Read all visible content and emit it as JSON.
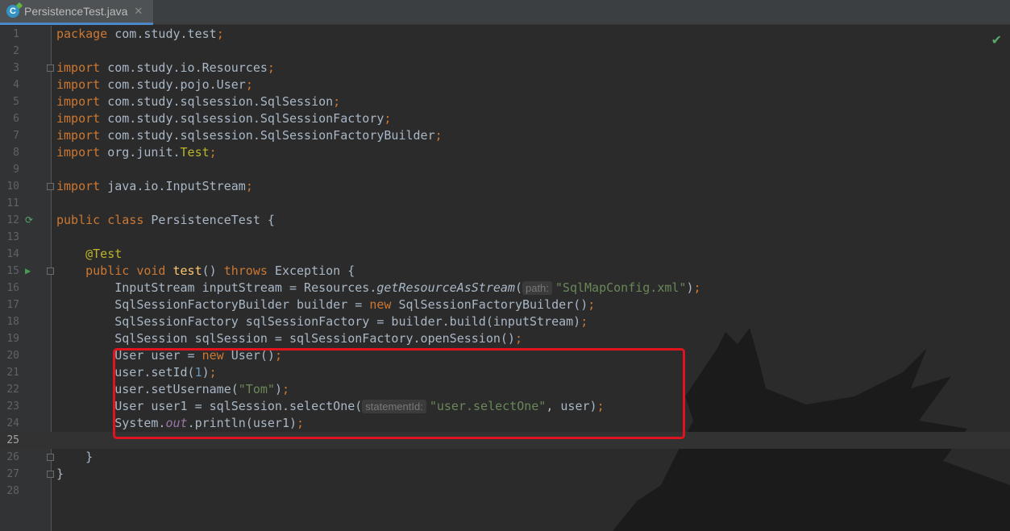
{
  "tab": {
    "title": "PersistenceTest.java",
    "close": "✕",
    "icon_label": "C",
    "icon": "java-class-icon"
  },
  "editor": {
    "current_line": 25,
    "status_icon": "✔",
    "lines": [
      {
        "n": "1"
      },
      {
        "n": "2"
      },
      {
        "n": "3"
      },
      {
        "n": "4"
      },
      {
        "n": "5"
      },
      {
        "n": "6"
      },
      {
        "n": "7"
      },
      {
        "n": "8"
      },
      {
        "n": "9"
      },
      {
        "n": "10"
      },
      {
        "n": "11"
      },
      {
        "n": "12"
      },
      {
        "n": "13"
      },
      {
        "n": "14"
      },
      {
        "n": "15"
      },
      {
        "n": "16"
      },
      {
        "n": "17"
      },
      {
        "n": "18"
      },
      {
        "n": "19"
      },
      {
        "n": "20"
      },
      {
        "n": "21"
      },
      {
        "n": "22"
      },
      {
        "n": "23"
      },
      {
        "n": "24"
      },
      {
        "n": "25"
      },
      {
        "n": "26"
      },
      {
        "n": "27"
      },
      {
        "n": "28"
      }
    ],
    "code": {
      "l1a": "package",
      "l1b": " com.study.test",
      "l1c": ";",
      "l3a": "import",
      "l3b": " com.study.io.Resources",
      "l3c": ";",
      "l4a": "import",
      "l4b": " com.study.pojo.User",
      "l4c": ";",
      "l5a": "import",
      "l5b": " com.study.sqlsession.SqlSession",
      "l5c": ";",
      "l6a": "import",
      "l6b": " com.study.sqlsession.SqlSessionFactory",
      "l6c": ";",
      "l7a": "import",
      "l7b": " com.study.sqlsession.SqlSessionFactoryBuilder",
      "l7c": ";",
      "l8a": "import",
      "l8b": " org.junit.",
      "l8c": "Test",
      "l8d": ";",
      "l10a": "import",
      "l10b": " java.io.InputStream",
      "l10c": ";",
      "l12a": "public class",
      "l12b": " PersistenceTest {",
      "l14a": "    @Test",
      "l15a": "    public void ",
      "l15b": "test",
      "l15c": "() ",
      "l15d": "throws",
      "l15e": " Exception {",
      "l16a": "        InputStream inputStream = Resources.",
      "l16b": "getResourceAsStream",
      "l16c": "(",
      "l16hint": "path:",
      "l16d": "\"SqlMapConfig.xml\"",
      "l16e": ")",
      "l16f": ";",
      "l17a": "        SqlSessionFactoryBuilder builder = ",
      "l17b": "new",
      "l17c": " SqlSessionFactoryBuilder()",
      "l17d": ";",
      "l18a": "        SqlSessionFactory sqlSessionFactory = builder.build(inputStream)",
      "l18b": ";",
      "l19a": "        SqlSession sqlSession = sqlSessionFactory.openSession()",
      "l19b": ";",
      "l20a": "        User user = ",
      "l20b": "new",
      "l20c": " User()",
      "l20d": ";",
      "l21a": "        user.setId(",
      "l21b": "1",
      "l21c": ")",
      "l21d": ";",
      "l22a": "        user.setUsername(",
      "l22b": "\"Tom\"",
      "l22c": ")",
      "l22d": ";",
      "l23a": "        User user1 = sqlSession.selectOne(",
      "l23hint": "statementId:",
      "l23b": "\"user.selectOne\"",
      "l23c": ", user)",
      "l23d": ";",
      "l24a": "        System.",
      "l24b": "out",
      "l24c": ".println(user1)",
      "l24d": ";",
      "l26a": "    }",
      "l27a": "}"
    }
  }
}
